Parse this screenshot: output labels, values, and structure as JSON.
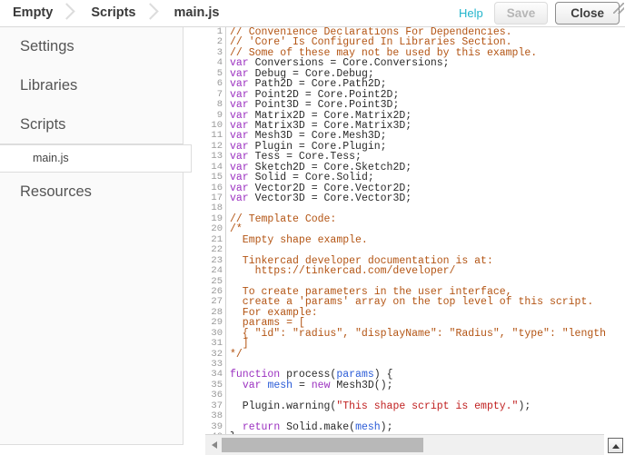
{
  "header": {
    "breadcrumb": [
      "Empty",
      "Scripts",
      "main.js"
    ],
    "help_label": "Help",
    "save_label": "Save",
    "close_label": "Close",
    "accent_link_color": "#23b5cc"
  },
  "sidebar": {
    "items": [
      {
        "label": "Settings"
      },
      {
        "label": "Libraries"
      },
      {
        "label": "Scripts"
      },
      {
        "label": "Resources"
      }
    ],
    "selected_file": "main.js"
  },
  "editor": {
    "language": "javascript",
    "first_line": 1,
    "last_line": 40,
    "colors": {
      "comment": "#b35413",
      "keyword": "#9b30c0",
      "variable": "#2a5bd7",
      "string": "#c02020",
      "plain": "#2a2a2a",
      "gutter": "#999999"
    },
    "lines": [
      {
        "n": 1,
        "tokens": [
          {
            "t": "// Convenience Declarations For Dependencies.",
            "c": "cm"
          }
        ]
      },
      {
        "n": 2,
        "tokens": [
          {
            "t": "// 'Core' Is Configured In Libraries Section.",
            "c": "cm"
          }
        ]
      },
      {
        "n": 3,
        "tokens": [
          {
            "t": "// Some of these may not be used by this example.",
            "c": "cm"
          }
        ]
      },
      {
        "n": 4,
        "tokens": [
          {
            "t": "var",
            "c": "kw"
          },
          {
            "t": " Conversions = Core.Conversions;",
            "c": "pl"
          }
        ]
      },
      {
        "n": 5,
        "tokens": [
          {
            "t": "var",
            "c": "kw"
          },
          {
            "t": " Debug = Core.Debug;",
            "c": "pl"
          }
        ]
      },
      {
        "n": 6,
        "tokens": [
          {
            "t": "var",
            "c": "kw"
          },
          {
            "t": " Path2D = Core.Path2D;",
            "c": "pl"
          }
        ]
      },
      {
        "n": 7,
        "tokens": [
          {
            "t": "var",
            "c": "kw"
          },
          {
            "t": " Point2D = Core.Point2D;",
            "c": "pl"
          }
        ]
      },
      {
        "n": 8,
        "tokens": [
          {
            "t": "var",
            "c": "kw"
          },
          {
            "t": " Point3D = Core.Point3D;",
            "c": "pl"
          }
        ]
      },
      {
        "n": 9,
        "tokens": [
          {
            "t": "var",
            "c": "kw"
          },
          {
            "t": " Matrix2D = Core.Matrix2D;",
            "c": "pl"
          }
        ]
      },
      {
        "n": 10,
        "tokens": [
          {
            "t": "var",
            "c": "kw"
          },
          {
            "t": " Matrix3D = Core.Matrix3D;",
            "c": "pl"
          }
        ]
      },
      {
        "n": 11,
        "tokens": [
          {
            "t": "var",
            "c": "kw"
          },
          {
            "t": " Mesh3D = Core.Mesh3D;",
            "c": "pl"
          }
        ]
      },
      {
        "n": 12,
        "tokens": [
          {
            "t": "var",
            "c": "kw"
          },
          {
            "t": " Plugin = Core.Plugin;",
            "c": "pl"
          }
        ]
      },
      {
        "n": 13,
        "tokens": [
          {
            "t": "var",
            "c": "kw"
          },
          {
            "t": " Tess = Core.Tess;",
            "c": "pl"
          }
        ]
      },
      {
        "n": 14,
        "tokens": [
          {
            "t": "var",
            "c": "kw"
          },
          {
            "t": " Sketch2D = Core.Sketch2D;",
            "c": "pl"
          }
        ]
      },
      {
        "n": 15,
        "tokens": [
          {
            "t": "var",
            "c": "kw"
          },
          {
            "t": " Solid = Core.Solid;",
            "c": "pl"
          }
        ]
      },
      {
        "n": 16,
        "tokens": [
          {
            "t": "var",
            "c": "kw"
          },
          {
            "t": " Vector2D = Core.Vector2D;",
            "c": "pl"
          }
        ]
      },
      {
        "n": 17,
        "tokens": [
          {
            "t": "var",
            "c": "kw"
          },
          {
            "t": " Vector3D = Core.Vector3D;",
            "c": "pl"
          }
        ]
      },
      {
        "n": 18,
        "tokens": []
      },
      {
        "n": 19,
        "tokens": [
          {
            "t": "// Template Code:",
            "c": "cm"
          }
        ]
      },
      {
        "n": 20,
        "tokens": [
          {
            "t": "/*",
            "c": "cm"
          }
        ]
      },
      {
        "n": 21,
        "tokens": [
          {
            "t": "  Empty shape example.",
            "c": "cm"
          }
        ]
      },
      {
        "n": 22,
        "tokens": []
      },
      {
        "n": 23,
        "tokens": [
          {
            "t": "  Tinkercad developer documentation is at:",
            "c": "cm"
          }
        ]
      },
      {
        "n": 24,
        "tokens": [
          {
            "t": "    https://tinkercad.com/developer/",
            "c": "cm"
          }
        ]
      },
      {
        "n": 25,
        "tokens": []
      },
      {
        "n": 26,
        "tokens": [
          {
            "t": "  To create parameters in the user interface,",
            "c": "cm"
          }
        ]
      },
      {
        "n": 27,
        "tokens": [
          {
            "t": "  create a 'params' array on the top level of this script.",
            "c": "cm"
          }
        ]
      },
      {
        "n": 28,
        "tokens": [
          {
            "t": "  For example:",
            "c": "cm"
          }
        ]
      },
      {
        "n": 29,
        "tokens": [
          {
            "t": "  params = [",
            "c": "cm"
          }
        ]
      },
      {
        "n": 30,
        "tokens": [
          {
            "t": "  { \"id\": \"radius\", \"displayName\": \"Radius\", \"type\": \"length\",",
            "c": "cm"
          }
        ]
      },
      {
        "n": 31,
        "tokens": [
          {
            "t": "  ]",
            "c": "cm"
          }
        ]
      },
      {
        "n": 32,
        "tokens": [
          {
            "t": "*/",
            "c": "cm"
          }
        ]
      },
      {
        "n": 33,
        "tokens": []
      },
      {
        "n": 34,
        "tokens": [
          {
            "t": "function",
            "c": "kw"
          },
          {
            "t": " process(",
            "c": "pl"
          },
          {
            "t": "params",
            "c": "var"
          },
          {
            "t": ") {",
            "c": "pl"
          }
        ]
      },
      {
        "n": 35,
        "tokens": [
          {
            "t": "  ",
            "c": "pl"
          },
          {
            "t": "var",
            "c": "kw"
          },
          {
            "t": " ",
            "c": "pl"
          },
          {
            "t": "mesh",
            "c": "var"
          },
          {
            "t": " = ",
            "c": "pl"
          },
          {
            "t": "new",
            "c": "kw"
          },
          {
            "t": " Mesh3D();",
            "c": "pl"
          }
        ]
      },
      {
        "n": 36,
        "tokens": []
      },
      {
        "n": 37,
        "tokens": [
          {
            "t": "  Plugin.warning(",
            "c": "pl"
          },
          {
            "t": "\"This shape script is empty.\"",
            "c": "str"
          },
          {
            "t": ");",
            "c": "pl"
          }
        ]
      },
      {
        "n": 38,
        "tokens": []
      },
      {
        "n": 39,
        "tokens": [
          {
            "t": "  ",
            "c": "pl"
          },
          {
            "t": "return",
            "c": "kw"
          },
          {
            "t": " Solid.make(",
            "c": "pl"
          },
          {
            "t": "mesh",
            "c": "var"
          },
          {
            "t": ");",
            "c": "pl"
          }
        ]
      },
      {
        "n": 40,
        "tokens": [
          {
            "t": "}",
            "c": "pl"
          }
        ]
      }
    ]
  }
}
